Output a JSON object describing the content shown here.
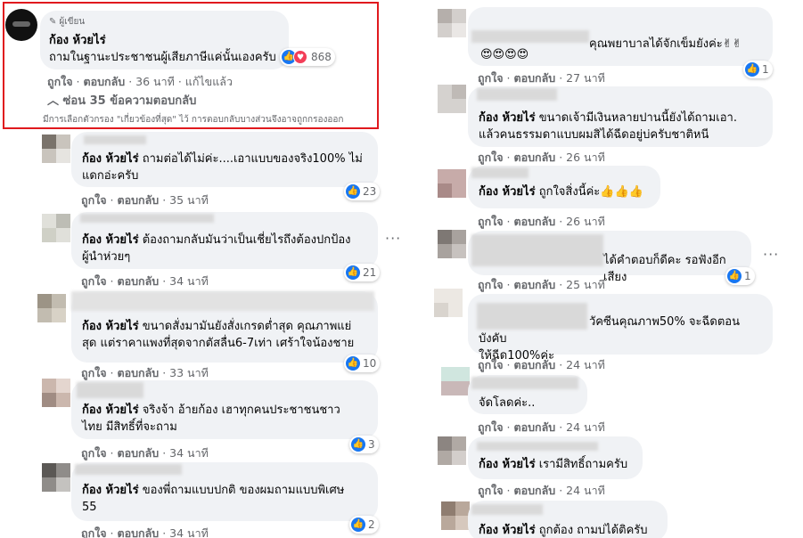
{
  "top": {
    "badge": "ผู้เขียน",
    "name": "ก้อง ห้วยไร่",
    "text": "ถามในฐานะประชาชนผู้เสียภาษีแค่นั้นเองครับ",
    "reactions": "868",
    "like": "ถูกใจ",
    "reply": "ตอบกลับ",
    "time": "36 นาที",
    "edited": "แก้ไขแล้ว",
    "hide_replies": "ซ่อน 35 ข้อความตอบกลับ",
    "filter_note": "มีการเลือกตัวกรอง \"เกี่ยวข้องที่สุด\" ไว้ การตอบกลับบางส่วนจึงอาจถูกกรองออก"
  },
  "actions": {
    "like": "ถูกใจ",
    "reply": "ตอบกลับ"
  },
  "left": [
    {
      "name": "ก้อง ห้วยไร่",
      "lines": [
        "ถามต่อได้ไม่ค่ะ....เอาแบบของจริง100% ไม่",
        "แดกอ่ะครับ"
      ],
      "count": "23",
      "time": "35 นาที"
    },
    {
      "name": "ก้อง ห้วยไร่",
      "lines": [
        "ต้องถามกลับมันว่าเป็นเชี่ยไรถึงต้องปกป้อง",
        "ผู้นำห่วยๆ"
      ],
      "count": "21",
      "time": "34 นาที"
    },
    {
      "name": "ก้อง ห้วยไร่",
      "lines": [
        "ขนาดสั่งมามันยังสั่งเกรดต่ำสุด คุณภาพแย่",
        "สุด แต่ราคาแพงที่สุดจากตัสลื่น6-7เท่า เศร้าใจน้องชาย"
      ],
      "count": "10",
      "time": "33 นาที"
    },
    {
      "name": "ก้อง ห้วยไร่",
      "lines": [
        "จริงจ้า อ้ายก้อง เฮาทุกคนประชาชนชาว",
        "ไทย มีสิทธิ์ที่จะถาม"
      ],
      "count": "3",
      "time": "34 นาที"
    },
    {
      "name": "ก้อง ห้วยไร่",
      "lines": [
        "ของพี่ถามแบบปกติ ของผมถามแบบพิเศษ",
        "55"
      ],
      "count": "2",
      "time": "34 นาที"
    }
  ],
  "right": [
    {
      "lines": [
        "คุณพยาบาลได้จักเข็มยังค่ะ✌✌"
      ],
      "emoji": "😍😍😍😍",
      "count": "1",
      "time": "27 นาที"
    },
    {
      "name": "ก้อง ห้วยไร่",
      "lines": [
        "ขนาดเจ้ามีเงินหลายปานนี้ยังได้ถามเอา.",
        "แล้วคนธรรมดาแบบผมสิได้ฉีดอยู่บ่ครับชาติหนี"
      ],
      "time": "26 นาที"
    },
    {
      "name": "ก้อง ห้วยไร่",
      "lines": [
        "ถูกใจสิ่งนี้ค่ะ👍👍👍"
      ],
      "time": "26 นาที"
    },
    {
      "lines": [
        "ได้คำตอบก็ดีคะ รอฟังอีกเสียง"
      ],
      "count": "1",
      "time": "25 นาที"
    },
    {
      "lines": [
        "วัคซีนคุณภาพ50% จะฉีดตอนบังคับ",
        "ให้ฉีด100%ค่ะ"
      ],
      "time": "24 นาที"
    },
    {
      "lines": [
        "จัดโลดค่ะ.."
      ],
      "time": "24 นาที"
    },
    {
      "name": "ก้อง ห้วยไร่",
      "lines": [
        "เรามีสิทธิ์ถามครับ"
      ],
      "time": "24 นาที"
    },
    {
      "name": "ก้อง ห้วยไร่",
      "lines": [
        "ถูกต้อง ถามบ่ได้ติครับ"
      ]
    }
  ]
}
